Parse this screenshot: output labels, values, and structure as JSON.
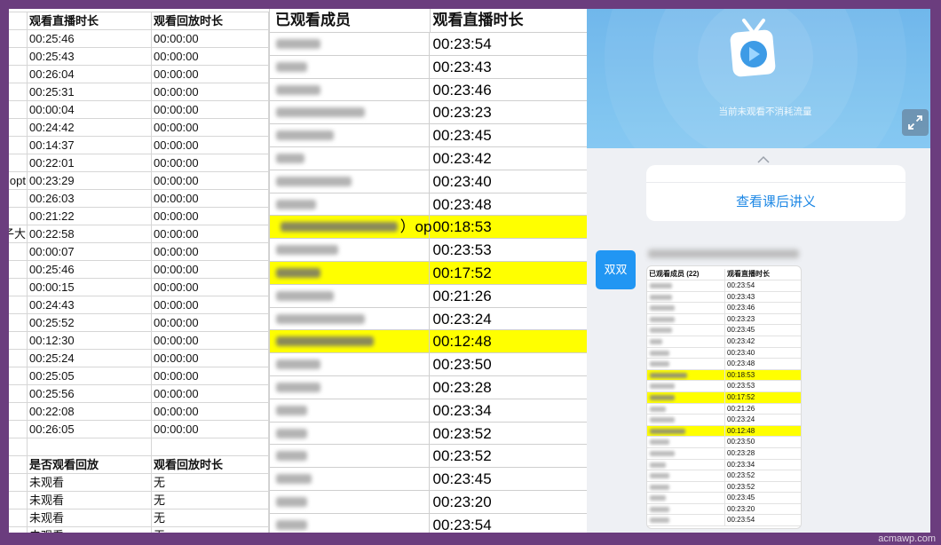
{
  "left_sheet": {
    "header": {
      "live": "观看直播时长",
      "replay": "观看回放时长"
    },
    "rows": [
      {
        "live": "00:25:46",
        "replay": "00:00:00"
      },
      {
        "live": "00:25:43",
        "replay": "00:00:00"
      },
      {
        "live": "00:26:04",
        "replay": "00:00:00"
      },
      {
        "live": "00:25:31",
        "replay": "00:00:00"
      },
      {
        "live": "00:00:04",
        "replay": "00:00:00"
      },
      {
        "live": "00:24:42",
        "replay": "00:00:00"
      },
      {
        "live": "00:14:37",
        "replay": "00:00:00"
      },
      {
        "live": "00:22:01",
        "replay": "00:00:00"
      },
      {
        "live": "00:23:29",
        "replay": "00:00:00",
        "edge": "opt"
      },
      {
        "live": "00:26:03",
        "replay": "00:00:00"
      },
      {
        "live": "00:21:22",
        "replay": "00:00:00"
      },
      {
        "live": "00:22:58",
        "replay": "00:00:00",
        "edge": "子大"
      },
      {
        "live": "00:00:07",
        "replay": "00:00:00"
      },
      {
        "live": "00:25:46",
        "replay": "00:00:00"
      },
      {
        "live": "00:00:15",
        "replay": "00:00:00"
      },
      {
        "live": "00:24:43",
        "replay": "00:00:00"
      },
      {
        "live": "00:25:52",
        "replay": "00:00:00"
      },
      {
        "live": "00:12:30",
        "replay": "00:00:00"
      },
      {
        "live": "00:25:24",
        "replay": "00:00:00"
      },
      {
        "live": "00:25:05",
        "replay": "00:00:00"
      },
      {
        "live": "00:25:56",
        "replay": "00:00:00"
      },
      {
        "live": "00:22:08",
        "replay": "00:00:00"
      },
      {
        "live": "00:26:05",
        "replay": "00:00:00"
      }
    ],
    "replay_section": {
      "header": {
        "watched": "是否观看回放",
        "replay": "观看回放时长"
      },
      "rows": [
        {
          "watched": "未观看",
          "replay": "无"
        },
        {
          "watched": "未观看",
          "replay": "无"
        },
        {
          "watched": "未观看",
          "replay": "无"
        },
        {
          "watched": "未观看",
          "replay": "无"
        }
      ]
    }
  },
  "middle_sheet": {
    "header": {
      "member": "已观看成员",
      "live": "观看直播时长"
    },
    "rows": [
      {
        "time": "00:23:54"
      },
      {
        "time": "00:23:43"
      },
      {
        "time": "00:23:46"
      },
      {
        "time": "00:23:23"
      },
      {
        "time": "00:23:45"
      },
      {
        "time": "00:23:42"
      },
      {
        "time": "00:23:40"
      },
      {
        "time": "00:23:48"
      },
      {
        "time": "00:18:53",
        "highlight": true,
        "name_suffix": "）op"
      },
      {
        "time": "00:23:53"
      },
      {
        "time": "00:17:52",
        "highlight": true
      },
      {
        "time": "00:21:26"
      },
      {
        "time": "00:23:24"
      },
      {
        "time": "00:12:48",
        "highlight": true
      },
      {
        "time": "00:23:50"
      },
      {
        "time": "00:23:28"
      },
      {
        "time": "00:23:34"
      },
      {
        "time": "00:23:52"
      },
      {
        "time": "00:23:52"
      },
      {
        "time": "00:23:45"
      },
      {
        "time": "00:23:20"
      },
      {
        "time": "00:23:54"
      }
    ]
  },
  "app": {
    "player": {
      "notice": "当前未观看不消耗流量",
      "icon": "tv-play-icon",
      "expand_icon": "fullscreen-expand-icon"
    },
    "collapse_icon": "chevron-up-icon",
    "handout_button": "查看课后讲义",
    "message": {
      "avatar_text": "双双",
      "avatar_color": "#2196f3",
      "image_header": {
        "member": "已观看成员 (22)",
        "live": "观看直播时长"
      }
    }
  },
  "colors": {
    "frame": "#6b3d7e",
    "highlight": "#ffff00",
    "link": "#1e88e5",
    "player_blue": "#75bfef"
  },
  "watermark": "acmawp.com"
}
